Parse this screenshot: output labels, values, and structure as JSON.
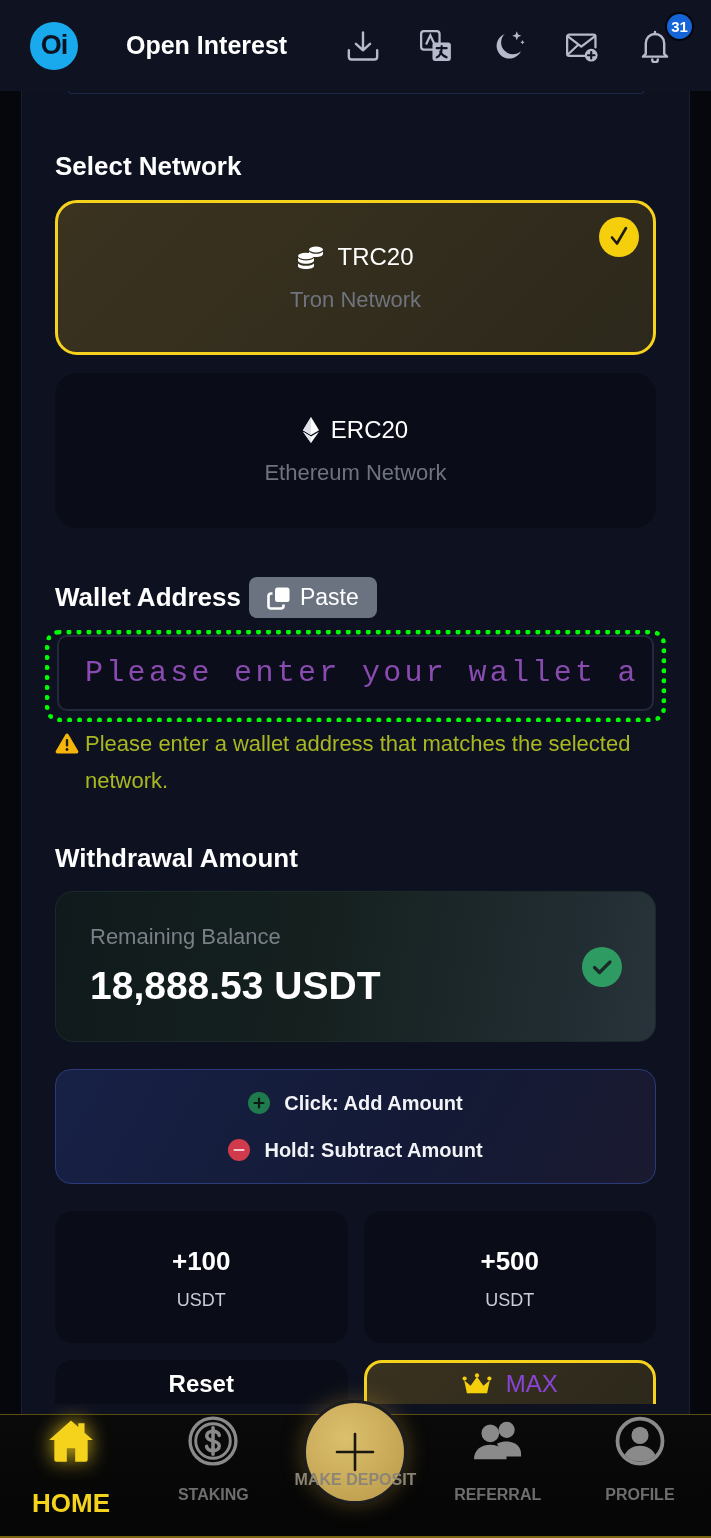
{
  "header": {
    "logo": "Oi",
    "title": "Open Interest",
    "notification_badge": "31"
  },
  "network_section": {
    "title": "Select Network",
    "options": [
      {
        "kind": "coins",
        "name": "TRC20",
        "network": "Tron Network",
        "selected": true
      },
      {
        "kind": "ethereum",
        "name": "ERC20",
        "network": "Ethereum Network",
        "selected": false
      }
    ]
  },
  "wallet": {
    "label": "Wallet Address",
    "paste_button": "Paste",
    "placeholder": "Please enter your wallet a",
    "highlighted": true,
    "warning": "Please enter a wallet address that matches the selected network."
  },
  "amount": {
    "title": "Withdrawal Amount",
    "balance_label": "Remaining Balance",
    "balance": "18,888.53 USDT",
    "verified": true,
    "hints": [
      {
        "kind": "add",
        "text": "Click: Add Amount"
      },
      {
        "kind": "subtract",
        "text": "Hold: Subtract Amount"
      }
    ],
    "presets": [
      {
        "kind": "amount",
        "value": "+100",
        "unit": "USDT",
        "selected": false
      },
      {
        "kind": "amount",
        "value": "+500",
        "unit": "USDT",
        "selected": false
      },
      {
        "kind": "reset",
        "value": "Reset",
        "selected": false
      },
      {
        "kind": "max",
        "value": "MAX",
        "selected": true
      }
    ]
  },
  "bottom_nav": [
    {
      "kind": "home",
      "label": "HOME",
      "selected": true
    },
    {
      "kind": "staking",
      "label": "STAKING",
      "selected": false
    },
    {
      "kind": "deposit",
      "label": "MAKE DEPOSIT",
      "selected": false
    },
    {
      "kind": "referral",
      "label": "REFERRAL",
      "selected": false
    },
    {
      "kind": "profile",
      "label": "PROFILE",
      "selected": false
    }
  ]
}
